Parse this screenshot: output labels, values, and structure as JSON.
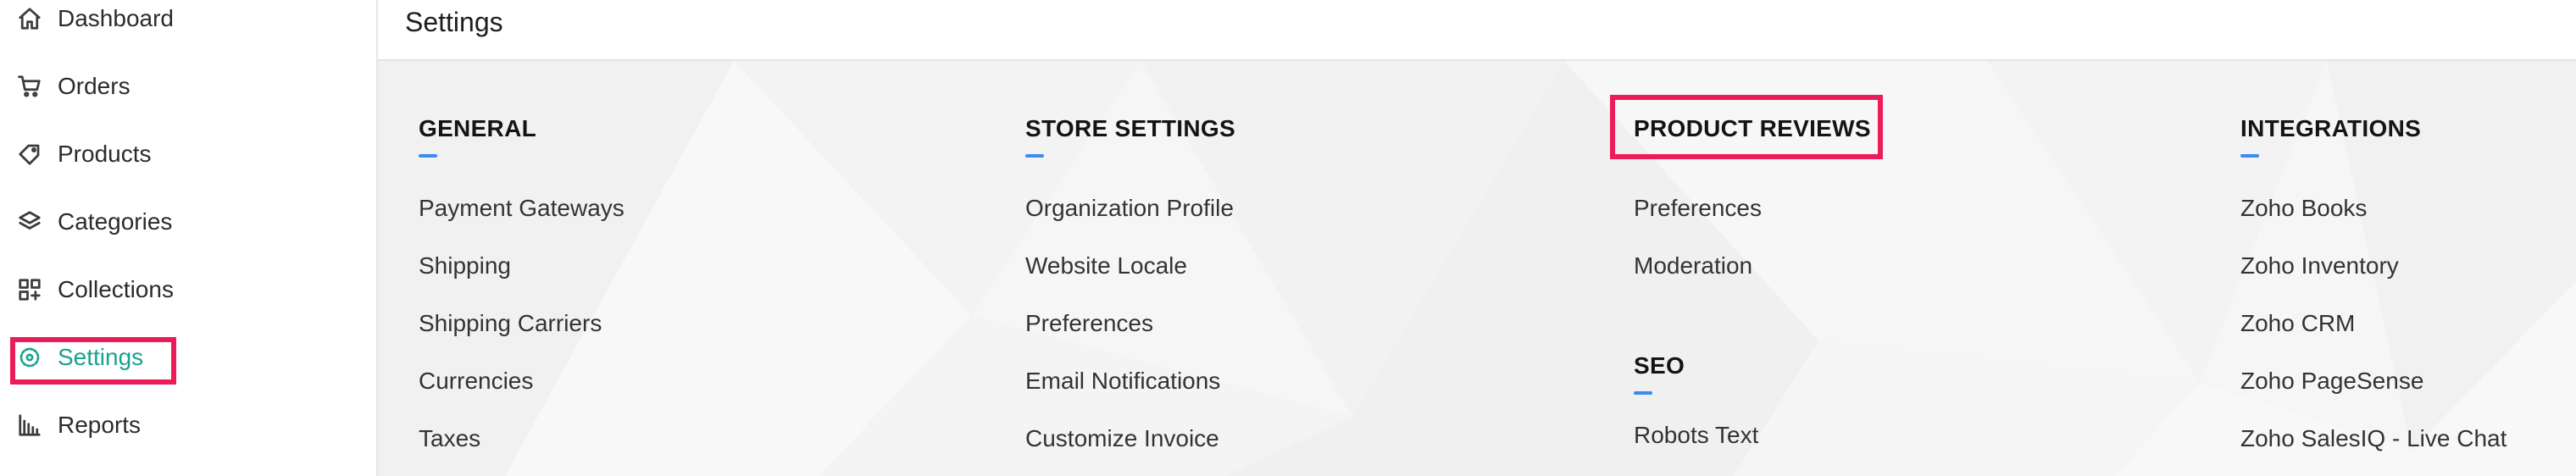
{
  "sidebar": {
    "items": [
      {
        "label": "Dashboard",
        "icon": "home-icon"
      },
      {
        "label": "Orders",
        "icon": "cart-icon"
      },
      {
        "label": "Products",
        "icon": "tag-icon"
      },
      {
        "label": "Categories",
        "icon": "layers-icon"
      },
      {
        "label": "Collections",
        "icon": "grid-plus-icon"
      },
      {
        "label": "Settings",
        "icon": "gear-icon",
        "active": true
      },
      {
        "label": "Reports",
        "icon": "bar-chart-icon"
      }
    ]
  },
  "header": {
    "title": "Settings"
  },
  "colors": {
    "accent": "#1aa28f",
    "highlight": "#ec1c5a",
    "underline": "#3b8cf0"
  },
  "sections": {
    "general": {
      "title": "GENERAL",
      "links": [
        "Payment Gateways",
        "Shipping",
        "Shipping Carriers",
        "Currencies",
        "Taxes"
      ]
    },
    "store_settings": {
      "title": "STORE SETTINGS",
      "links": [
        "Organization Profile",
        "Website Locale",
        "Preferences",
        "Email Notifications",
        "Customize Invoice"
      ]
    },
    "product_reviews": {
      "title": "PRODUCT REVIEWS",
      "links": [
        "Preferences",
        "Moderation"
      ]
    },
    "seo": {
      "title": "SEO",
      "links": [
        "Robots Text"
      ]
    },
    "integrations": {
      "title": "INTEGRATIONS",
      "links": [
        "Zoho Books",
        "Zoho Inventory",
        "Zoho CRM",
        "Zoho PageSense",
        "Zoho SalesIQ - Live Chat"
      ]
    }
  }
}
